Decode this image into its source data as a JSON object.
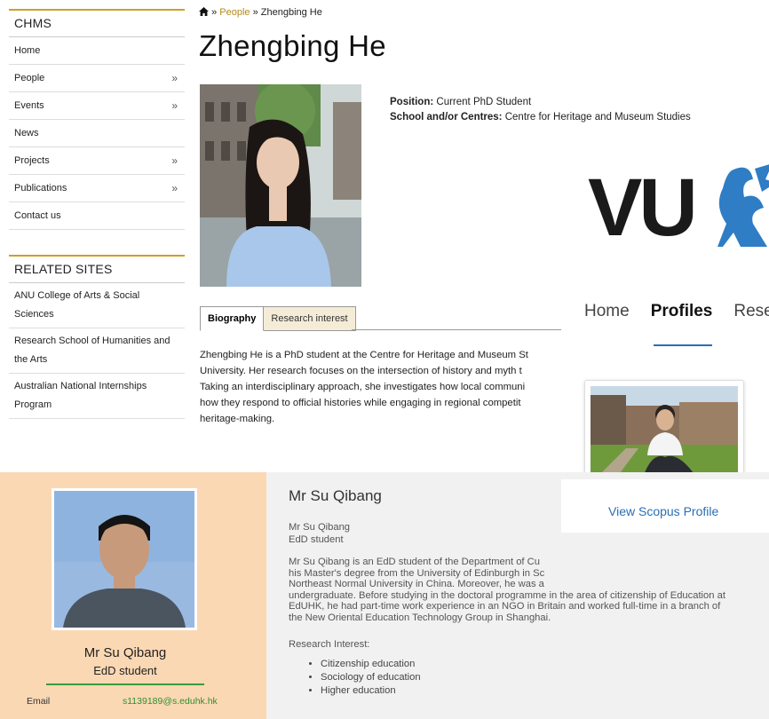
{
  "chms": {
    "sidebar_title": "CHMS",
    "nav": [
      {
        "label": "Home",
        "arrow": ""
      },
      {
        "label": "People",
        "arrow": "»"
      },
      {
        "label": "Events",
        "arrow": "»"
      },
      {
        "label": "News",
        "arrow": ""
      },
      {
        "label": "Projects",
        "arrow": "»"
      },
      {
        "label": "Publications",
        "arrow": "»"
      },
      {
        "label": "Contact us",
        "arrow": ""
      }
    ],
    "related_title": "RELATED SITES",
    "related": [
      "ANU College of Arts & Social Sciences",
      "Research School of Humanities and the Arts",
      "Australian National Internships Program"
    ],
    "breadcrumb": {
      "sep": "»",
      "people": "People",
      "current": "Zhengbing He"
    },
    "title": "Zhengbing He",
    "position_label": "Position:",
    "position_value": "Current PhD Student",
    "school_label": "School and/or Centres:",
    "school_value": "Centre for Heritage and Museum Studies",
    "tabs": [
      "Biography",
      "Research interest"
    ],
    "bio_lines": [
      "Zhengbing He is a PhD student at the Centre for Heritage and Museum St",
      "University. Her research focuses on the intersection of history and myth t",
      "Taking an interdisciplinary approach, she investigates how local communi",
      "how they respond to official histories while engaging in regional competit",
      "heritage-making."
    ]
  },
  "vu": {
    "logo_text": "VU",
    "nav": [
      "Home",
      "Profiles",
      "Rese"
    ],
    "link": "View Scopus Profile"
  },
  "eduhk": {
    "name": "Mr Su Qibang",
    "role": "EdD student",
    "email_label": "Email",
    "email": "s1139189@s.eduhk.hk",
    "heading": "Mr Su Qibang",
    "sub_name": "Mr Su Qibang",
    "sub_role": "EdD student",
    "para": [
      "Mr Su Qibang is an EdD student of the Department of Cu",
      "his Master's degree from the University of Edinburgh in Sc",
      "Northeast Normal University in China. Moreover, he was a",
      "undergraduate. Before studying in the doctoral programme in the area of citizenship of Education at",
      "EdUHK, he had part-time work experience in an NGO in Britain and worked full-time in a branch of",
      "the New Oriental Education Technology Group in Shanghai."
    ],
    "interest_label": "Research Interest:",
    "interests": [
      "Citizenship education",
      "Sociology of education",
      "Higher education"
    ]
  }
}
